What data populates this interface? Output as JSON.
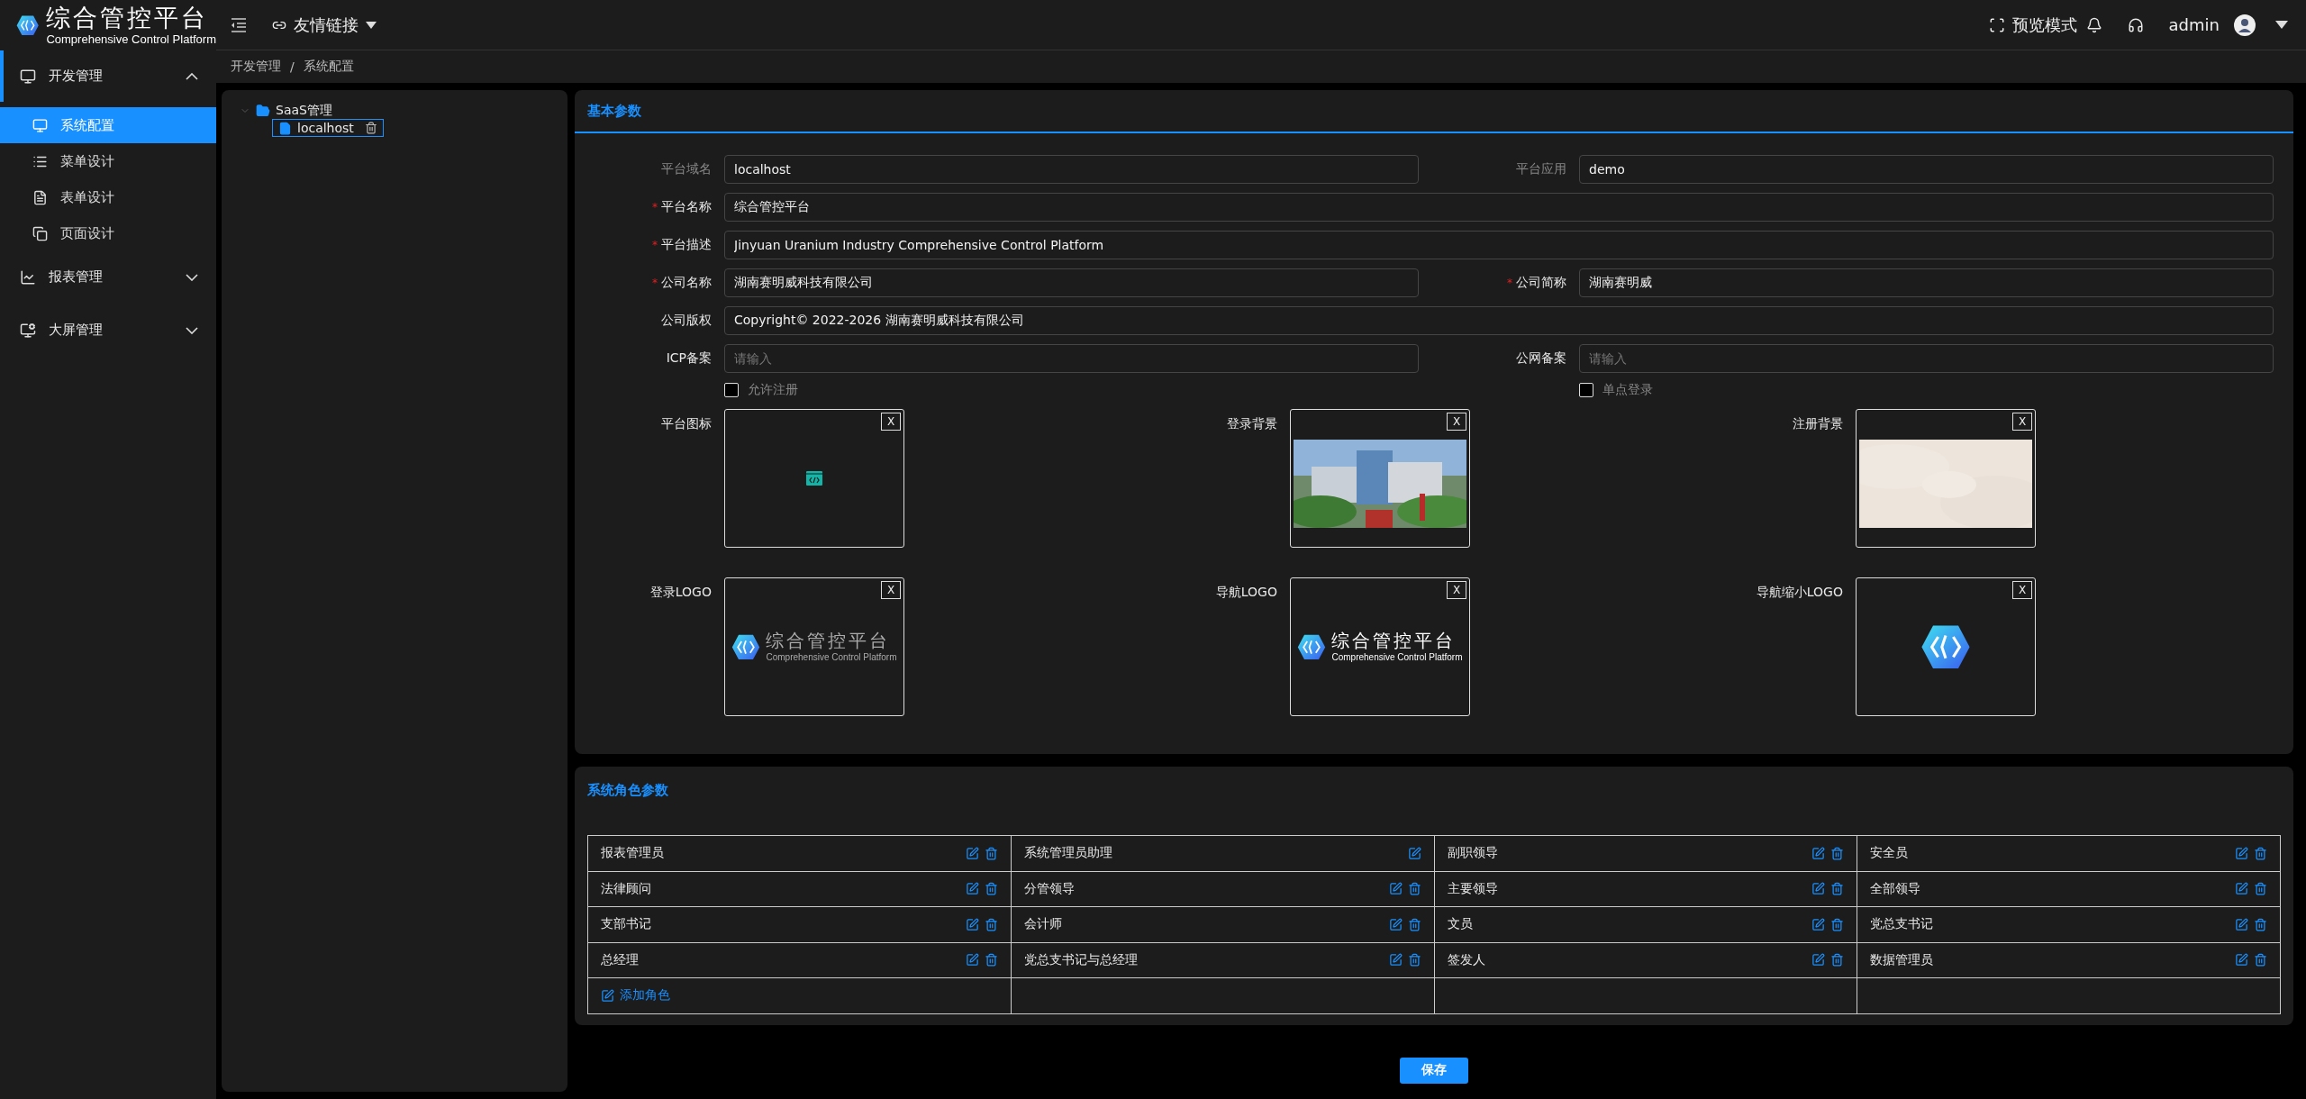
{
  "brand": {
    "title": "综合管控平台",
    "subtitle": "Comprehensive Control Platform"
  },
  "header": {
    "link_menu": "友情链接",
    "preview": "预览模式",
    "user": "admin"
  },
  "sidebar": {
    "items": [
      {
        "label": "开发管理",
        "expanded": true,
        "children": [
          {
            "label": "系统配置",
            "selected": true
          },
          {
            "label": "菜单设计",
            "selected": false
          },
          {
            "label": "表单设计",
            "selected": false
          },
          {
            "label": "页面设计",
            "selected": false
          }
        ]
      },
      {
        "label": "报表管理",
        "expanded": false
      },
      {
        "label": "大屏管理",
        "expanded": false
      }
    ]
  },
  "breadcrumb": [
    "开发管理",
    "系统配置"
  ],
  "breadcrumb_separator": "/",
  "tree": [
    {
      "label": "SaaS管理",
      "expanded": true,
      "children": [
        {
          "label": "localhost",
          "selected": true
        }
      ]
    }
  ],
  "basic": {
    "title": "基本参数",
    "required_mark": "*",
    "rows": [
      [
        {
          "label": "平台域名",
          "value": "localhost",
          "required": false,
          "disabled": true
        },
        {
          "label": "平台应用",
          "value": "demo",
          "required": false,
          "disabled": true
        }
      ],
      [
        {
          "label": "平台名称",
          "value": "综合管控平台",
          "required": true,
          "disabled": false
        }
      ],
      [
        {
          "label": "平台描述",
          "value": "Jinyuan Uranium Industry Comprehensive Control Platform",
          "required": true,
          "disabled": false
        }
      ],
      [
        {
          "label": "公司名称",
          "value": "湖南赛明威科技有限公司",
          "required": true,
          "disabled": false
        },
        {
          "label": "公司简称",
          "value": "湖南赛明威",
          "required": true,
          "disabled": false
        }
      ],
      [
        {
          "label": "公司版权",
          "value": "Copyright© 2022-2026 湖南赛明威科技有限公司",
          "required": false,
          "disabled": false
        }
      ],
      [
        {
          "label": "ICP备案",
          "placeholder": "请输入",
          "required": false,
          "disabled": false
        },
        {
          "label": "公网备案",
          "placeholder": "请输入",
          "required": false,
          "disabled": false
        }
      ]
    ],
    "checks": [
      {
        "label": "允许注册",
        "checked": false
      },
      {
        "label": "单点登录",
        "checked": false
      }
    ],
    "images": [
      {
        "label": "平台图标",
        "kind": "icon",
        "remove": "X"
      },
      {
        "label": "登录背景",
        "remove": "X"
      },
      {
        "label": "注册背景",
        "kind": "texture",
        "remove": "X"
      },
      {
        "label": "登录LOGO",
        "kind": "logo",
        "dim": true,
        "logo_title": "综合管控平台",
        "logo_subtitle": "Comprehensive Control Platform",
        "remove": "X"
      },
      {
        "label": "导航LOGO",
        "kind": "logo",
        "dim": false,
        "logo_title": "综合管控平台",
        "logo_subtitle": "Comprehensive Control Platform",
        "remove": "X"
      },
      {
        "label": "导航缩小LOGO",
        "kind": "mark",
        "remove": "X"
      }
    ]
  },
  "roles": {
    "title": "系统角色参数",
    "add": "添加角色",
    "items": [
      {
        "name": "报表管理员",
        "deletable": true
      },
      {
        "name": "系统管理员助理",
        "deletable": false
      },
      {
        "name": "副职领导",
        "deletable": true
      },
      {
        "name": "安全员",
        "deletable": true
      },
      {
        "name": "法律顾问",
        "deletable": true
      },
      {
        "name": "分管领导",
        "deletable": true
      },
      {
        "name": "主要领导",
        "deletable": true
      },
      {
        "name": "全部领导",
        "deletable": true
      },
      {
        "name": "支部书记",
        "deletable": true
      },
      {
        "name": "会计师",
        "deletable": true
      },
      {
        "name": "文员",
        "deletable": true
      },
      {
        "name": "党总支书记",
        "deletable": true
      },
      {
        "name": "总经理",
        "deletable": true
      },
      {
        "name": "党总支书记与总经理",
        "deletable": true
      },
      {
        "name": "签发人",
        "deletable": true
      },
      {
        "name": "数据管理员",
        "deletable": true
      }
    ]
  },
  "save": "保存"
}
